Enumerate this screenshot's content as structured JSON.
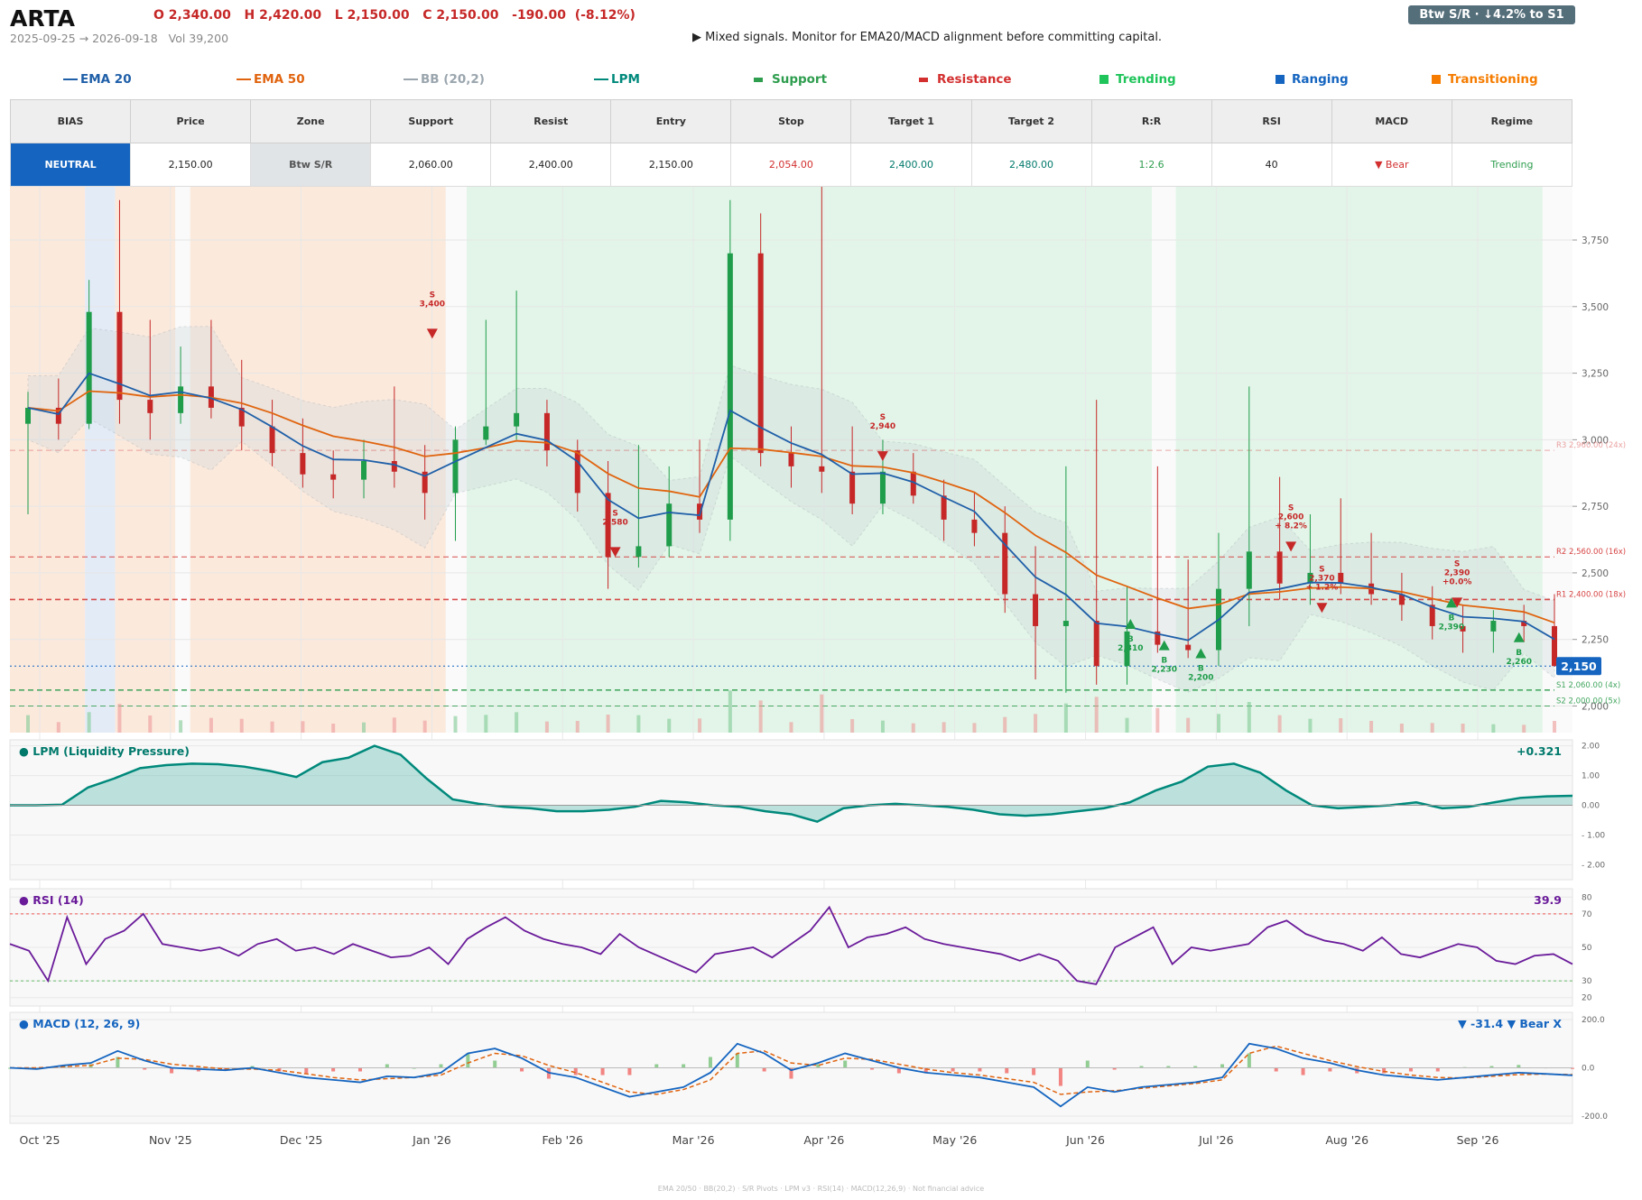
{
  "header": {
    "ticker": "ARTA",
    "ohlc": "O 2,340.00   H 2,420.00   L 2,150.00   C 2,150.00   -190.00  (-8.12%)",
    "range": "2025-09-25 → 2026-09-18   Vol 39,200",
    "signal": "▶  Mixed signals. Monitor for EMA20/MACD alignment before committing capital.",
    "badge": "Btw S/R  ·  ↓4.2% to S1"
  },
  "legend": [
    {
      "label": "EMA 20",
      "color": "#1f5fa8",
      "kind": "line"
    },
    {
      "label": "EMA 50",
      "color": "#e0640f",
      "kind": "line"
    },
    {
      "label": "BB (20,2)",
      "color": "#9aa5ad",
      "kind": "line"
    },
    {
      "label": "LPM",
      "color": "#00897b",
      "kind": "line"
    },
    {
      "label": "Support",
      "color": "#2e9d4e",
      "kind": "dash"
    },
    {
      "label": "Resistance",
      "color": "#d32f2f",
      "kind": "dash"
    },
    {
      "label": "Trending",
      "color": "#1fc45a",
      "kind": "square"
    },
    {
      "label": "Ranging",
      "color": "#1565c0",
      "kind": "square"
    },
    {
      "label": "Transitioning",
      "color": "#f57c00",
      "kind": "square"
    }
  ],
  "table": {
    "headers": [
      "BIAS",
      "Price",
      "Zone",
      "Support",
      "Resist",
      "Entry",
      "Stop",
      "Target 1",
      "Target 2",
      "R:R",
      "RSI",
      "MACD",
      "Regime"
    ],
    "values": [
      "NEUTRAL",
      "2,150.00",
      "Btw S/R",
      "2,060.00",
      "2,400.00",
      "2,150.00",
      "2,054.00",
      "2,400.00",
      "2,480.00",
      "1:2.6",
      "40",
      "▼ Bear",
      "Trending"
    ],
    "value_colors": [
      "#ffffff",
      "#222222",
      "#555555",
      "#222222",
      "#222222",
      "#222222",
      "#d32f2f",
      "#00796b",
      "#00796b",
      "#2e9d4e",
      "#222222",
      "#d32f2f",
      "#2e9d4e"
    ]
  },
  "chart_data": [
    {
      "type": "candlestick",
      "title": "",
      "x_ticks": [
        "Oct '25",
        "Nov '25",
        "Dec '25",
        "Jan '26",
        "Feb '26",
        "Mar '26",
        "Apr '26",
        "May '26",
        "Jun '26",
        "Jul '26",
        "Aug '26",
        "Sep '26"
      ],
      "y_ticks": [
        "2,000",
        "2,250",
        "2,500",
        "2,750",
        "3,000",
        "3,250",
        "3,500",
        "3,750"
      ],
      "ylim": [
        1900,
        3950
      ],
      "last_price_label": "2,150",
      "last_price": 2150,
      "regimes": [
        {
          "label": "Transitioning",
          "start_week": 0,
          "end_week": 2.5
        },
        {
          "label": "Ranging",
          "start_week": 2.5,
          "end_week": 3.5
        },
        {
          "label": "Transitioning",
          "start_week": 3.5,
          "end_week": 5.5
        },
        {
          "label": "Transitioning",
          "start_week": 6,
          "end_week": 14.5
        },
        {
          "label": "Trending",
          "start_week": 15.2,
          "end_week": 38
        },
        {
          "label": "Trending",
          "start_week": 38.8,
          "end_week": 51
        }
      ],
      "levels": [
        {
          "label": "R3 2,960.00 (24x)",
          "value": 2960,
          "kind": "resistance"
        },
        {
          "label": "R2 2,560.00 (16x)",
          "value": 2560,
          "kind": "resistance"
        },
        {
          "label": "R1 2,400.00 (18x)",
          "value": 2400,
          "kind": "resistance"
        },
        {
          "label": "S1 2,060.00 (4x)",
          "value": 2060,
          "kind": "support"
        },
        {
          "label": "S2 2,000.00 (5x)",
          "value": 2000,
          "kind": "support"
        }
      ],
      "ohlc_weekly": [
        {
          "o": 3060,
          "h": 3180,
          "l": 2720,
          "c": 3120
        },
        {
          "o": 3120,
          "h": 3230,
          "l": 3000,
          "c": 3060
        },
        {
          "o": 3060,
          "h": 3600,
          "l": 3040,
          "c": 3480
        },
        {
          "o": 3480,
          "h": 3900,
          "l": 3060,
          "c": 3150
        },
        {
          "o": 3150,
          "h": 3450,
          "l": 3000,
          "c": 3100
        },
        {
          "o": 3100,
          "h": 3350,
          "l": 3060,
          "c": 3200
        },
        {
          "o": 3200,
          "h": 3450,
          "l": 3080,
          "c": 3120
        },
        {
          "o": 3120,
          "h": 3300,
          "l": 2960,
          "c": 3050
        },
        {
          "o": 3050,
          "h": 3150,
          "l": 2900,
          "c": 2950
        },
        {
          "o": 2950,
          "h": 3080,
          "l": 2820,
          "c": 2870
        },
        {
          "o": 2870,
          "h": 2960,
          "l": 2780,
          "c": 2850
        },
        {
          "o": 2850,
          "h": 3000,
          "l": 2780,
          "c": 2920
        },
        {
          "o": 2920,
          "h": 3200,
          "l": 2820,
          "c": 2880
        },
        {
          "o": 2880,
          "h": 2980,
          "l": 2700,
          "c": 2800
        },
        {
          "o": 2800,
          "h": 3050,
          "l": 2620,
          "c": 3000
        },
        {
          "o": 3000,
          "h": 3450,
          "l": 2980,
          "c": 3050
        },
        {
          "o": 3050,
          "h": 3560,
          "l": 3000,
          "c": 3100
        },
        {
          "o": 3100,
          "h": 3150,
          "l": 2900,
          "c": 2960
        },
        {
          "o": 2960,
          "h": 3000,
          "l": 2730,
          "c": 2800
        },
        {
          "o": 2800,
          "h": 2920,
          "l": 2440,
          "c": 2560
        },
        {
          "o": 2560,
          "h": 2980,
          "l": 2520,
          "c": 2600
        },
        {
          "o": 2600,
          "h": 2900,
          "l": 2560,
          "c": 2760
        },
        {
          "o": 2760,
          "h": 3000,
          "l": 2650,
          "c": 2700
        },
        {
          "o": 2700,
          "h": 3900,
          "l": 2620,
          "c": 3700
        },
        {
          "o": 3700,
          "h": 3850,
          "l": 2900,
          "c": 2950
        },
        {
          "o": 2950,
          "h": 3050,
          "l": 2820,
          "c": 2900
        },
        {
          "o": 2900,
          "h": 3950,
          "l": 2800,
          "c": 2880
        },
        {
          "o": 2880,
          "h": 3050,
          "l": 2720,
          "c": 2760
        },
        {
          "o": 2760,
          "h": 3000,
          "l": 2720,
          "c": 2880
        },
        {
          "o": 2880,
          "h": 2950,
          "l": 2760,
          "c": 2790
        },
        {
          "o": 2790,
          "h": 2850,
          "l": 2620,
          "c": 2700
        },
        {
          "o": 2700,
          "h": 2800,
          "l": 2600,
          "c": 2650
        },
        {
          "o": 2650,
          "h": 2750,
          "l": 2350,
          "c": 2420
        },
        {
          "o": 2420,
          "h": 2600,
          "l": 2100,
          "c": 2300
        },
        {
          "o": 2300,
          "h": 2900,
          "l": 2050,
          "c": 2320
        },
        {
          "o": 2320,
          "h": 3150,
          "l": 2080,
          "c": 2150
        },
        {
          "o": 2150,
          "h": 2450,
          "l": 2080,
          "c": 2280
        },
        {
          "o": 2280,
          "h": 2900,
          "l": 2200,
          "c": 2230
        },
        {
          "o": 2230,
          "h": 2550,
          "l": 2180,
          "c": 2210
        },
        {
          "o": 2210,
          "h": 2650,
          "l": 2150,
          "c": 2440
        },
        {
          "o": 2440,
          "h": 3200,
          "l": 2300,
          "c": 2580
        },
        {
          "o": 2580,
          "h": 2860,
          "l": 2400,
          "c": 2460
        },
        {
          "o": 2460,
          "h": 2720,
          "l": 2380,
          "c": 2500
        },
        {
          "o": 2500,
          "h": 2780,
          "l": 2420,
          "c": 2460
        },
        {
          "o": 2460,
          "h": 2650,
          "l": 2380,
          "c": 2420
        },
        {
          "o": 2420,
          "h": 2500,
          "l": 2320,
          "c": 2380
        },
        {
          "o": 2380,
          "h": 2450,
          "l": 2250,
          "c": 2300
        },
        {
          "o": 2300,
          "h": 2380,
          "l": 2200,
          "c": 2280
        },
        {
          "o": 2280,
          "h": 2360,
          "l": 2200,
          "c": 2320
        },
        {
          "o": 2320,
          "h": 2380,
          "l": 2240,
          "c": 2300
        },
        {
          "o": 2300,
          "h": 2420,
          "l": 2150,
          "c": 2150
        }
      ],
      "signals": [
        {
          "week": 15,
          "dir": "S",
          "label": "S\n3,400",
          "price": 3400
        },
        {
          "week": 21.5,
          "dir": "S",
          "label": "S\n2,580",
          "price": 2580
        },
        {
          "week": 31,
          "dir": "S",
          "label": "S\n2,940",
          "price": 2940
        },
        {
          "week": 39.8,
          "dir": "B",
          "label": "B\n2,310",
          "price": 2310
        },
        {
          "week": 41,
          "dir": "B",
          "label": "B\n2,230",
          "price": 2230
        },
        {
          "week": 42.3,
          "dir": "B",
          "label": "B\n2,200",
          "price": 2200
        },
        {
          "week": 45.5,
          "dir": "S",
          "label": "S\n2,600\n+ 8.2%",
          "price": 2600
        },
        {
          "week": 46.6,
          "dir": "S",
          "label": "S\n2,370\n+ 1.2%",
          "price": 2370
        },
        {
          "week": 51.2,
          "dir": "B",
          "label": "B\n2,390",
          "price": 2390
        },
        {
          "week": 51.4,
          "dir": "S",
          "label": "S\n2,390\n+0.0%",
          "price": 2390
        },
        {
          "week": 53.6,
          "dir": "B",
          "label": "B\n2,260",
          "price": 2260
        }
      ]
    },
    {
      "type": "area",
      "title": "LPM (Liquidity Pressure)",
      "value_label": "+0.321",
      "y_ticks": [
        "2.00",
        "1.00",
        "0.00",
        "- 1.00",
        "- 2.00"
      ],
      "ylim": [
        -2.5,
        2.2
      ],
      "values": [
        0,
        0,
        0.02,
        0.6,
        0.9,
        1.25,
        1.35,
        1.4,
        1.38,
        1.3,
        1.15,
        0.95,
        1.45,
        1.6,
        2.0,
        1.7,
        0.9,
        0.2,
        0.05,
        -0.05,
        -0.1,
        -0.2,
        -0.2,
        -0.15,
        -0.05,
        0.15,
        0.1,
        0,
        -0.05,
        -0.2,
        -0.3,
        -0.55,
        -0.1,
        0,
        0.05,
        0,
        -0.05,
        -0.15,
        -0.3,
        -0.35,
        -0.3,
        -0.2,
        -0.1,
        0.1,
        0.5,
        0.8,
        1.3,
        1.4,
        1.1,
        0.5,
        0,
        -0.1,
        -0.05,
        0,
        0.1,
        -0.1,
        -0.05,
        0.1,
        0.25,
        0.3,
        0.32
      ]
    },
    {
      "type": "line",
      "title": "RSI (14)",
      "value_label": "39.9",
      "y_ticks": [
        "80",
        "70",
        "50",
        "30",
        "20"
      ],
      "ylim": [
        15,
        85
      ],
      "bands": [
        70,
        30
      ],
      "values": [
        52,
        48,
        30,
        68,
        40,
        55,
        60,
        70,
        52,
        50,
        48,
        50,
        45,
        52,
        55,
        48,
        50,
        46,
        52,
        48,
        44,
        45,
        50,
        40,
        55,
        62,
        68,
        60,
        55,
        52,
        50,
        46,
        58,
        50,
        45,
        40,
        35,
        46,
        48,
        50,
        44,
        52,
        60,
        74,
        50,
        56,
        58,
        62,
        55,
        52,
        50,
        48,
        46,
        42,
        46,
        42,
        30,
        28,
        50,
        56,
        62,
        40,
        50,
        48,
        50,
        52,
        62,
        66,
        58,
        54,
        52,
        48,
        56,
        46,
        44,
        48,
        52,
        50,
        42,
        40,
        45,
        46,
        40
      ]
    },
    {
      "type": "line",
      "title": "MACD (12, 26, 9)",
      "value_label": "▼ -31.4 ▼ Bear X",
      "y_ticks": [
        "200.0",
        "0.0",
        "-200.0"
      ],
      "ylim": [
        -230,
        230
      ],
      "series": [
        {
          "name": "MACD",
          "values": [
            0,
            -5,
            10,
            20,
            70,
            30,
            0,
            -5,
            -10,
            0,
            -20,
            -40,
            -50,
            -60,
            -35,
            -40,
            -20,
            60,
            80,
            40,
            -20,
            -40,
            -80,
            -120,
            -100,
            -80,
            -20,
            100,
            60,
            -10,
            20,
            60,
            30,
            0,
            -20,
            -30,
            -40,
            -60,
            -80,
            -160,
            -80,
            -100,
            -80,
            -70,
            -60,
            -40,
            100,
            80,
            40,
            20,
            -10,
            -30,
            -40,
            -50,
            -40,
            -30,
            -20,
            -25,
            -31
          ]
        },
        {
          "name": "Signal",
          "values": [
            0,
            0,
            5,
            10,
            40,
            35,
            15,
            5,
            -5,
            -5,
            -10,
            -25,
            -40,
            -50,
            -45,
            -40,
            -30,
            20,
            60,
            50,
            10,
            -20,
            -60,
            -100,
            -110,
            -90,
            -50,
            60,
            70,
            20,
            10,
            40,
            35,
            15,
            -5,
            -20,
            -30,
            -45,
            -60,
            -110,
            -100,
            -95,
            -85,
            -75,
            -65,
            -50,
            60,
            90,
            60,
            30,
            5,
            -15,
            -30,
            -40,
            -42,
            -35,
            -28,
            -26,
            -28
          ]
        }
      ]
    }
  ],
  "footer": "EMA 20/50  ·  BB(20,2)  ·  S/R Pivots  ·  LPM v3  ·  RSI(14)  ·  MACD(12,26,9)  ·  Not financial advice"
}
